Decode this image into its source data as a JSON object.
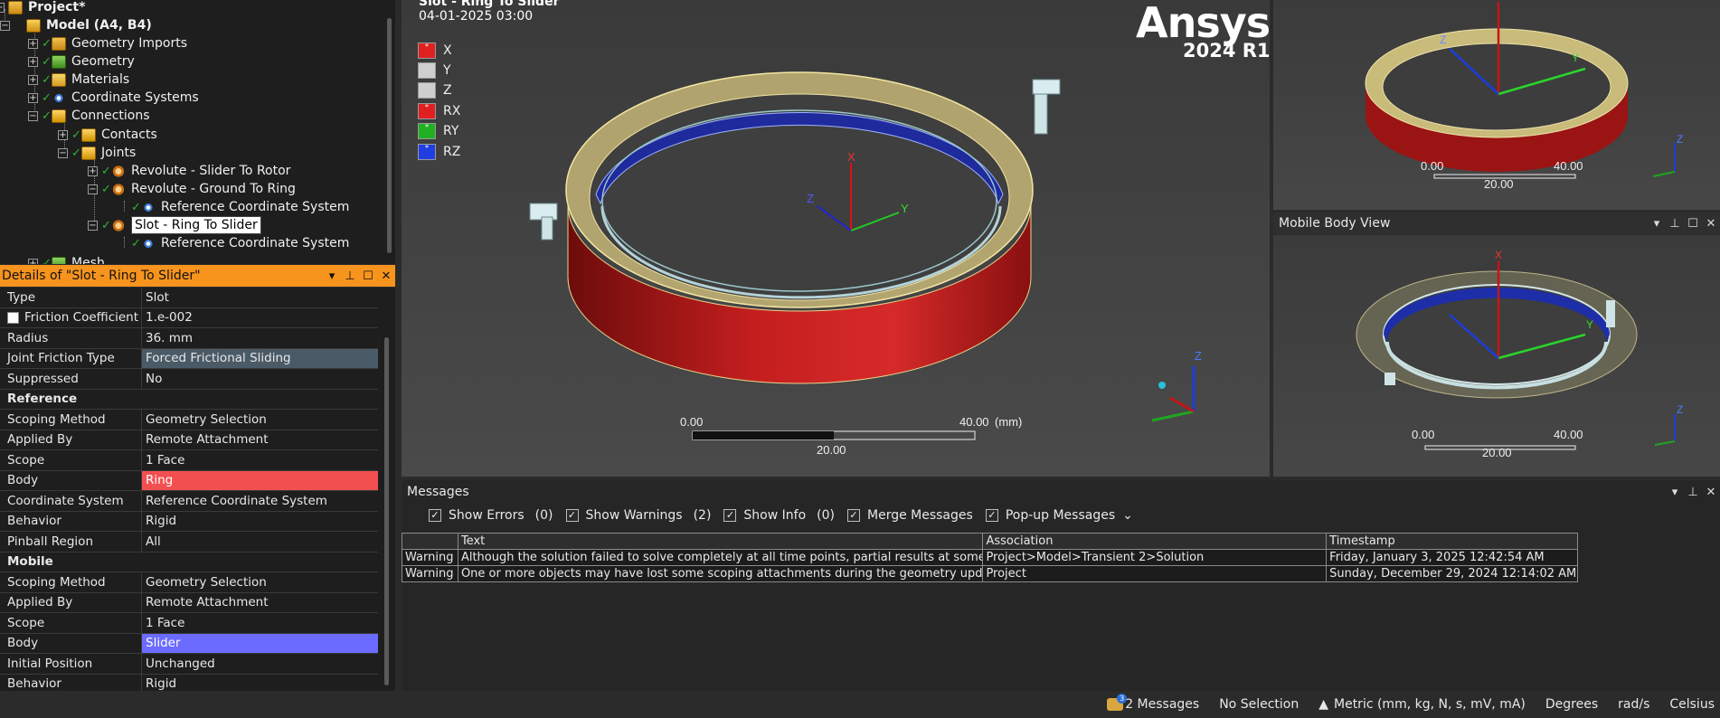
{
  "tree": {
    "items": [
      {
        "label": "Project*"
      },
      {
        "label": "Model (A4, B4)"
      },
      {
        "label": "Geometry Imports"
      },
      {
        "label": "Geometry"
      },
      {
        "label": "Materials"
      },
      {
        "label": "Coordinate Systems"
      },
      {
        "label": "Connections"
      },
      {
        "label": "Contacts"
      },
      {
        "label": "Joints"
      },
      {
        "label": "Revolute - Slider To Rotor"
      },
      {
        "label": "Revolute - Ground To Ring"
      },
      {
        "label": "Reference Coordinate System"
      },
      {
        "label": "Slot - Ring To Slider"
      },
      {
        "label": "Reference Coordinate System"
      },
      {
        "label": "Mesh"
      }
    ]
  },
  "details": {
    "title": "Details of \"Slot - Ring To Slider\"",
    "rows": [
      {
        "k": "Type",
        "v": "Slot"
      },
      {
        "k": "Friction Coefficient",
        "v": "1.e-002"
      },
      {
        "k": "Radius",
        "v": "36. mm"
      },
      {
        "k": "Joint Friction Type",
        "v": "Forced Frictional Sliding"
      },
      {
        "k": "Suppressed",
        "v": "No"
      },
      {
        "k": "Reference",
        "v": ""
      },
      {
        "k": "Scoping Method",
        "v": "Geometry Selection"
      },
      {
        "k": "Applied By",
        "v": "Remote Attachment"
      },
      {
        "k": "Scope",
        "v": "1 Face"
      },
      {
        "k": "Body",
        "v": "Ring"
      },
      {
        "k": "Coordinate System",
        "v": "Reference Coordinate System"
      },
      {
        "k": "Behavior",
        "v": "Rigid"
      },
      {
        "k": "Pinball Region",
        "v": "All"
      },
      {
        "k": "Mobile",
        "v": ""
      },
      {
        "k": "Scoping Method",
        "v": "Geometry Selection"
      },
      {
        "k": "Applied By",
        "v": "Remote Attachment"
      },
      {
        "k": "Scope",
        "v": "1 Face"
      },
      {
        "k": "Body",
        "v": "Slider"
      },
      {
        "k": "Initial Position",
        "v": "Unchanged"
      },
      {
        "k": "Behavior",
        "v": "Rigid"
      }
    ]
  },
  "viewport": {
    "title": "Slot - Ring To Slider",
    "date": "04-01-2025 03:00",
    "legend": [
      "X",
      "Y",
      "Z",
      "RX",
      "RY",
      "RZ"
    ],
    "legend_colors": [
      "#e02020",
      "#cfcfcf",
      "#cfcfcf",
      "#e02020",
      "#22b022",
      "#1f3fe0"
    ],
    "logo": "Ansys",
    "version": "2024 R1",
    "scale": {
      "left": "0.00",
      "right": "40.00",
      "unit": "(mm)",
      "mid": "20.00"
    },
    "axes": {
      "x": "X",
      "y": "Y",
      "z": "Z"
    }
  },
  "view_top": {
    "scale": {
      "left": "0.00",
      "right": "40.00",
      "mid": "20.00"
    }
  },
  "mobile_view": {
    "title": "Mobile Body View",
    "scale": {
      "left": "0.00",
      "right": "40.00",
      "mid": "20.00"
    }
  },
  "messages": {
    "title": "Messages",
    "toolbar": [
      {
        "label": "Show Errors",
        "count": "(0)"
      },
      {
        "label": "Show Warnings",
        "count": "(2)"
      },
      {
        "label": "Show Info",
        "count": "(0)"
      },
      {
        "label": "Merge Messages",
        "count": ""
      },
      {
        "label": "Pop-up Messages",
        "count": ""
      }
    ],
    "columns": [
      "",
      "Text",
      "Association",
      "Timestamp"
    ],
    "rows": [
      [
        "Warning",
        "Although the solution failed to solve completely at all time points, partial results at some",
        "Project>Model>Transient 2>Solution",
        "Friday, January 3, 2025 12:42:54 AM"
      ],
      [
        "Warning",
        "One or more objects may have lost some scoping attachments during the geometry update",
        "Project",
        "Sunday, December 29, 2024 12:14:02 AM"
      ]
    ]
  },
  "status": {
    "messages": "2 Messages",
    "badge": "3",
    "selection": "No Selection",
    "units": "Metric (mm, kg, N, s, mV, mA)",
    "angle": "Degrees",
    "rate": "rad/s",
    "temp": "Celsius"
  },
  "icons": {
    "check": "check-icon",
    "expand": "plus-box-icon",
    "collapse": "minus-box-icon",
    "pin": "pin-icon",
    "maximize": "maximize-icon",
    "close": "close-icon",
    "dropdown": "chevron-down-icon"
  }
}
